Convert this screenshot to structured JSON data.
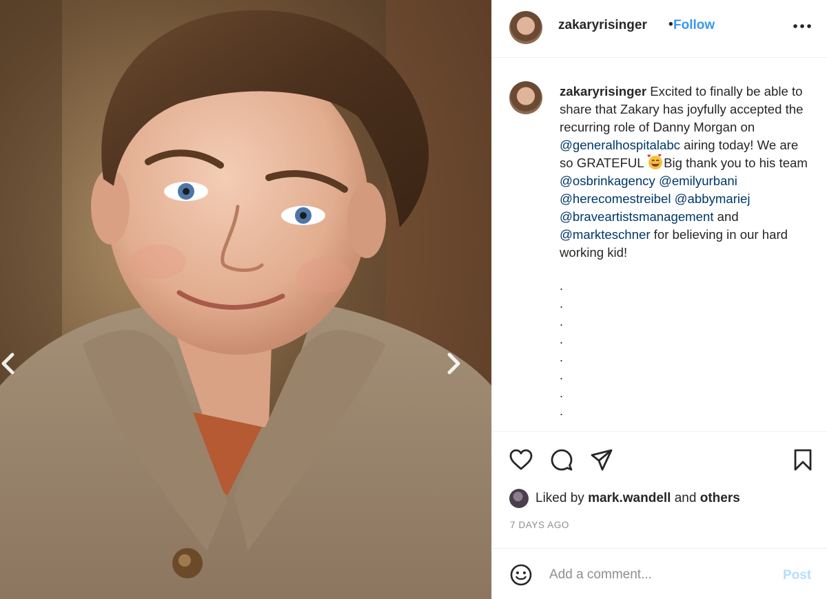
{
  "post": {
    "username": "zakaryrisinger",
    "separator": "•",
    "follow_label": "Follow",
    "more_icon": "more-horizontal-icon"
  },
  "caption": {
    "username": "zakaryrisinger",
    "text_1": " Excited to finally be able to share that Zakary has joyfully accepted the recurring role of Danny Morgan on ",
    "mention_1": "@generalhospitalabc",
    "text_2": " airing today! We are so GRATEFUL ",
    "emoji_icon": "smiling-face-with-hearts-icon",
    "text_3": "Big thank you to his team ",
    "mention_2": "@osbrinkagency",
    "mention_3": "@emilyurbani",
    "mention_4": "@herecomestreibel",
    "mention_5": "@abbymariej",
    "mention_6": "@braveartistsmanagement",
    "text_4": " and ",
    "mention_7": "@markteschner",
    "text_5": " for believing in our hard working kid!",
    "dots": [
      ".",
      ".",
      ".",
      ".",
      ".",
      ".",
      ".",
      "."
    ]
  },
  "likes": {
    "prefix": "Liked by ",
    "user": "mark.wandell",
    "middle": " and ",
    "others": "others"
  },
  "timestamp": "7 DAYS AGO",
  "comment": {
    "placeholder": "Add a comment...",
    "post_label": "Post"
  },
  "colors": {
    "follow": "#3897f0",
    "mention": "#00376b",
    "post_disabled": "#b2dffc",
    "muted": "#8e8e8e"
  }
}
